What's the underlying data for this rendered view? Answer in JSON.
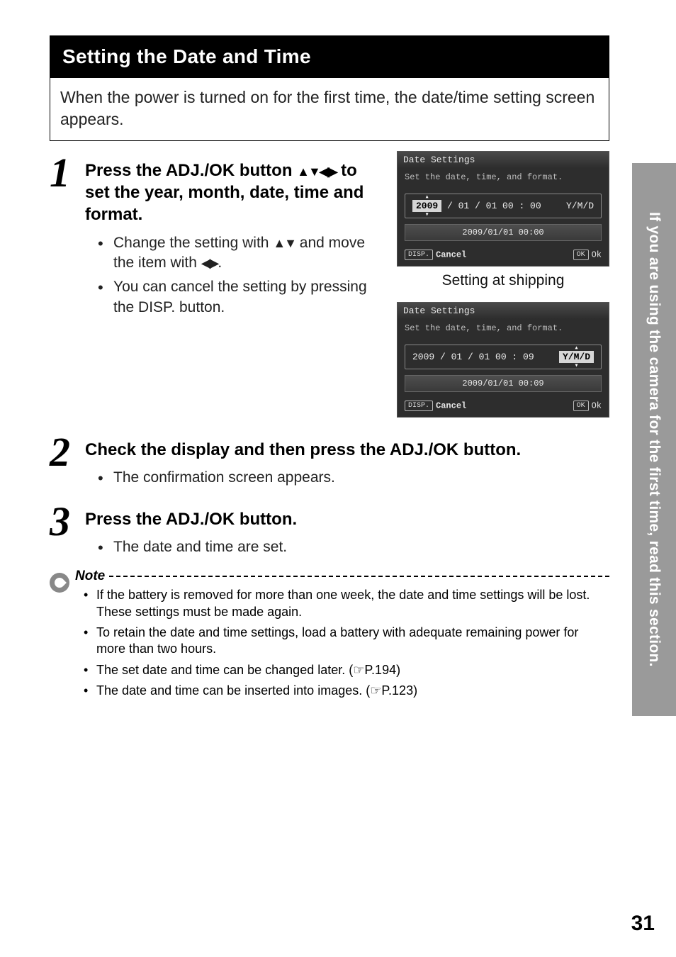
{
  "sideTab": "If you are using the camera for the first time, read this section.",
  "title": "Setting the Date and Time",
  "intro": "When the power is turned on for the first time, the date/time setting screen appears.",
  "steps": {
    "s1": {
      "num": "1",
      "head_a": "Press the ADJ./OK button ",
      "head_b": " to set the year, month, date, time and format.",
      "bullet1a": "Change the setting with ",
      "bullet1b": " and move the item with ",
      "bullet1c": ".",
      "bullet2": "You can cancel the setting by pressing the DISP. button."
    },
    "s2": {
      "num": "2",
      "head": "Check the display and then press the ADJ./OK button.",
      "bullet1": "The confirmation screen appears."
    },
    "s3": {
      "num": "3",
      "head": "Press the ADJ./OK button.",
      "bullet1": "The date and time are set."
    }
  },
  "lcd": {
    "screen1": {
      "title": "Date Settings",
      "subtitle": "Set the date, time, and format.",
      "year": "2009",
      "rest": "/ 01 / 01    00 : 00",
      "format": "Y/M/D",
      "preview": "2009/01/01 00:00",
      "cancelChip": "DISP.",
      "cancel": "Cancel",
      "okChip": "OK",
      "ok": "Ok"
    },
    "caption1": "Setting at shipping",
    "screen2": {
      "title": "Date Settings",
      "subtitle": "Set the date, time, and format.",
      "date": "2009 / 01 / 01    00 : 09",
      "format": "Y/M/D",
      "preview": "2009/01/01 00:09",
      "cancelChip": "DISP.",
      "cancel": "Cancel",
      "okChip": "OK",
      "ok": "Ok"
    }
  },
  "note": {
    "label": "Note",
    "items": [
      "If the battery is removed for more than one week, the date and time settings will be lost. These settings must be made again.",
      "To retain the date and time settings, load a battery with adequate remaining power for more than two hours.",
      "The set date and time can be changed later. (☞P.194)",
      "The date and time can be inserted into images. (☞P.123)"
    ]
  },
  "pageNumber": "31"
}
